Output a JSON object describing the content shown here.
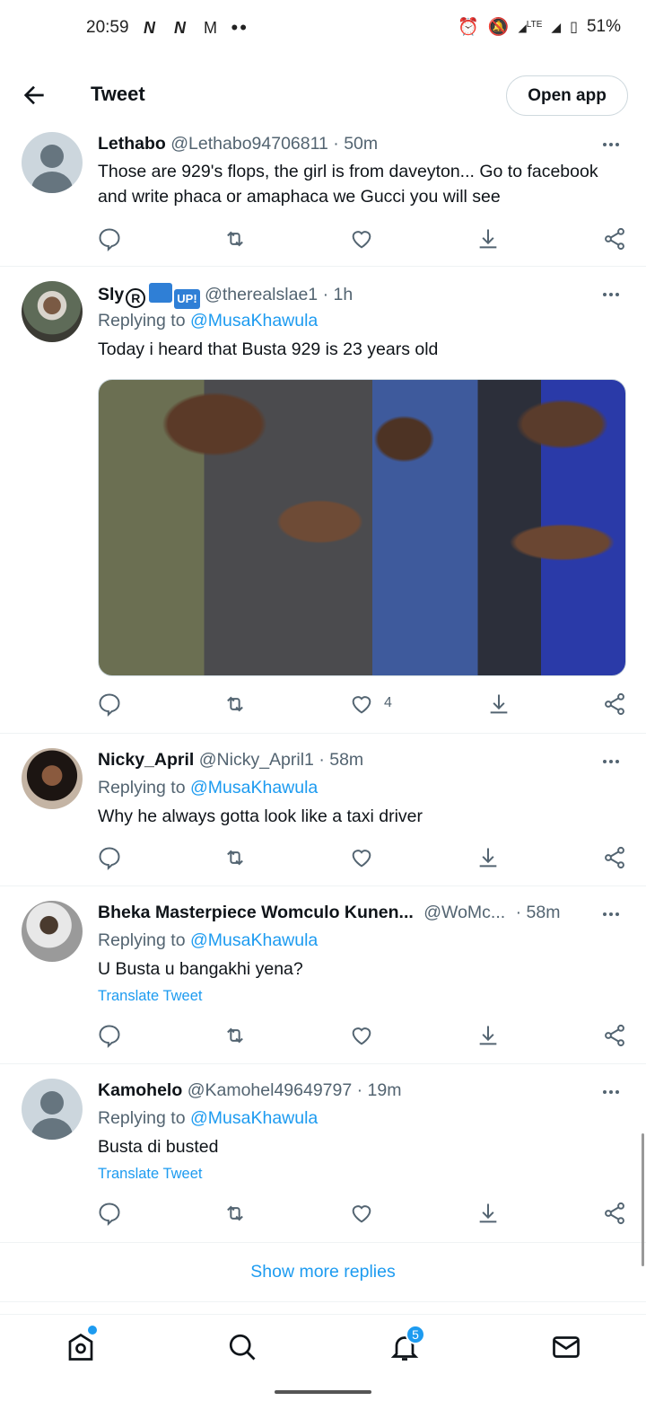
{
  "status_bar": {
    "time": "20:59",
    "battery": "51%",
    "network": "LTE"
  },
  "header": {
    "title": "Tweet",
    "open_app_label": "Open app"
  },
  "tweets": [
    {
      "name": "Lethabo",
      "handle": "@Lethabo94706811",
      "time": "· 50m",
      "replying_prefix": "",
      "replying_handle": "",
      "text": "Those are 929's flops, the girl is from daveyton... Go to facebook and write phaca or amaphaca we Gucci you will see",
      "translate": "",
      "likes": ""
    },
    {
      "name": "Sly",
      "handle": "@therealslae1",
      "time": "· 1h",
      "replying_prefix": "Replying to ",
      "replying_handle": "@MusaKhawula",
      "text": "Today i heard that Busta 929 is 23 years old",
      "translate": "",
      "likes": "4",
      "badge_up": "UP!",
      "badge_r": "R"
    },
    {
      "name": "Nicky_April",
      "handle": "@Nicky_April1",
      "time": "· 58m",
      "replying_prefix": "Replying to ",
      "replying_handle": "@MusaKhawula",
      "text": "Why he always gotta look like a taxi driver",
      "translate": "",
      "likes": ""
    },
    {
      "name": "Bheka Masterpiece Womculo Kunen...",
      "handle": "@WoMc...",
      "time": "· 58m",
      "replying_prefix": "Replying to ",
      "replying_handle": "@MusaKhawula",
      "text": "U Busta u bangakhi yena?",
      "translate": "Translate Tweet",
      "likes": ""
    },
    {
      "name": "Kamohelo",
      "handle": "@Kamohel49649797",
      "time": "· 19m",
      "replying_prefix": "Replying to ",
      "replying_handle": "@MusaKhawula",
      "text": "Busta di busted",
      "translate": "Translate Tweet",
      "likes": ""
    }
  ],
  "show_more": "Show more replies",
  "nav": {
    "notifications_badge": "5"
  },
  "icons": [
    "back-arrow-icon",
    "reply-icon",
    "retweet-icon",
    "like-icon",
    "bookmark-download-icon",
    "share-icon",
    "home-icon",
    "search-icon",
    "bell-icon",
    "mail-icon"
  ],
  "colors": {
    "accent": "#1d9bf0",
    "text": "#0f1419",
    "secondary": "#536471"
  }
}
